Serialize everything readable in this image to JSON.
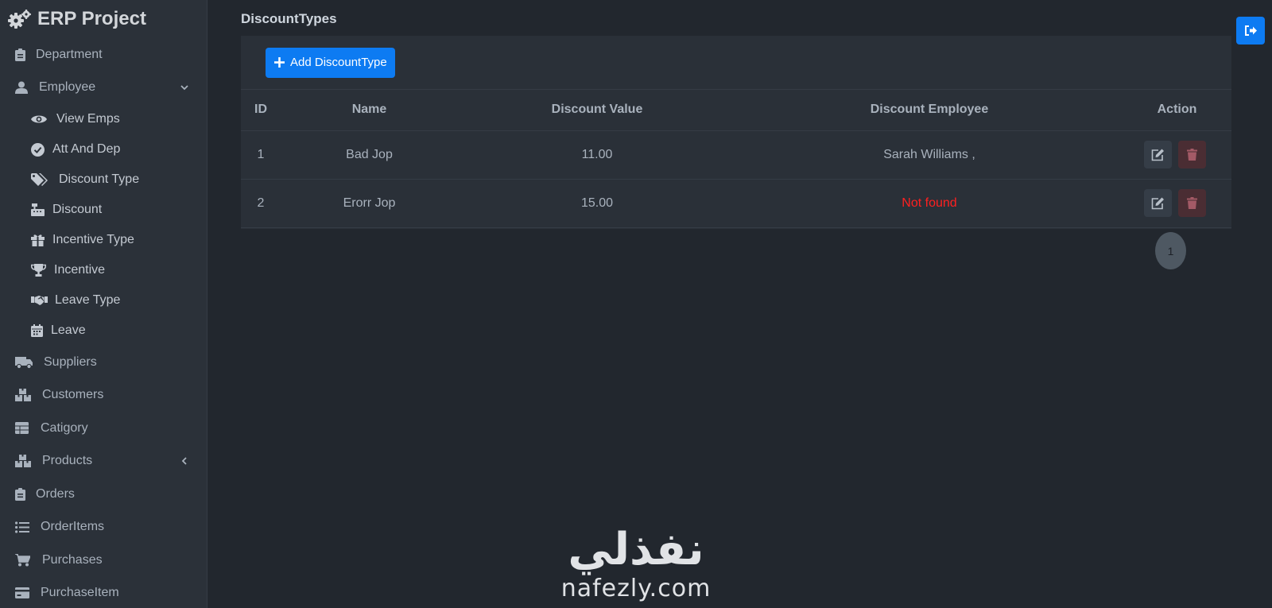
{
  "brand": {
    "title": "ERP Project"
  },
  "sidebar": {
    "items": [
      {
        "label": "Department",
        "icon": "clipboard-icon"
      },
      {
        "label": "Employee",
        "icon": "user-icon",
        "expanded": true,
        "children": [
          {
            "label": "View Emps",
            "icon": "eye-icon"
          },
          {
            "label": "Att And Dep",
            "icon": "check-circle-icon"
          },
          {
            "label": "Discount Type",
            "icon": "tags-icon"
          },
          {
            "label": "Discount",
            "icon": "cash-register-icon"
          },
          {
            "label": "Incentive Type",
            "icon": "gift-icon"
          },
          {
            "label": "Incentive",
            "icon": "trophy-icon"
          },
          {
            "label": "Leave Type",
            "icon": "handshake-icon"
          },
          {
            "label": "Leave",
            "icon": "calendar-icon"
          }
        ]
      },
      {
        "label": "Suppliers",
        "icon": "truck-icon"
      },
      {
        "label": "Customers",
        "icon": "boxes-icon"
      },
      {
        "label": "Catigory",
        "icon": "table-icon"
      },
      {
        "label": "Products",
        "icon": "boxes-icon",
        "expanded": false
      },
      {
        "label": "Orders",
        "icon": "clipboard-icon"
      },
      {
        "label": "OrderItems",
        "icon": "list-icon"
      },
      {
        "label": "Purchases",
        "icon": "cart-icon"
      },
      {
        "label": "PurchaseItem",
        "icon": "card-icon"
      }
    ]
  },
  "page": {
    "title": "DiscountTypes"
  },
  "toolbar": {
    "add_label": "Add DiscountType"
  },
  "table": {
    "columns": [
      "ID",
      "Name",
      "Discount Value",
      "Discount Employee",
      "Action"
    ],
    "rows": [
      {
        "id": "1",
        "name": "Bad Jop",
        "value": "11.00",
        "employee": "Sarah Williams ,",
        "status": "found"
      },
      {
        "id": "2",
        "name": "Erorr Jop",
        "value": "15.00",
        "employee": "Not found",
        "status": "not-found"
      }
    ]
  },
  "pagination": {
    "current": "1"
  },
  "colors": {
    "accent": "#0d7bf2",
    "danger": "#ff2020",
    "background": "#22272e",
    "sidebar": "#2b3139"
  },
  "watermark": {
    "arabic": "نفذلي",
    "latin": "nafezly.com"
  }
}
